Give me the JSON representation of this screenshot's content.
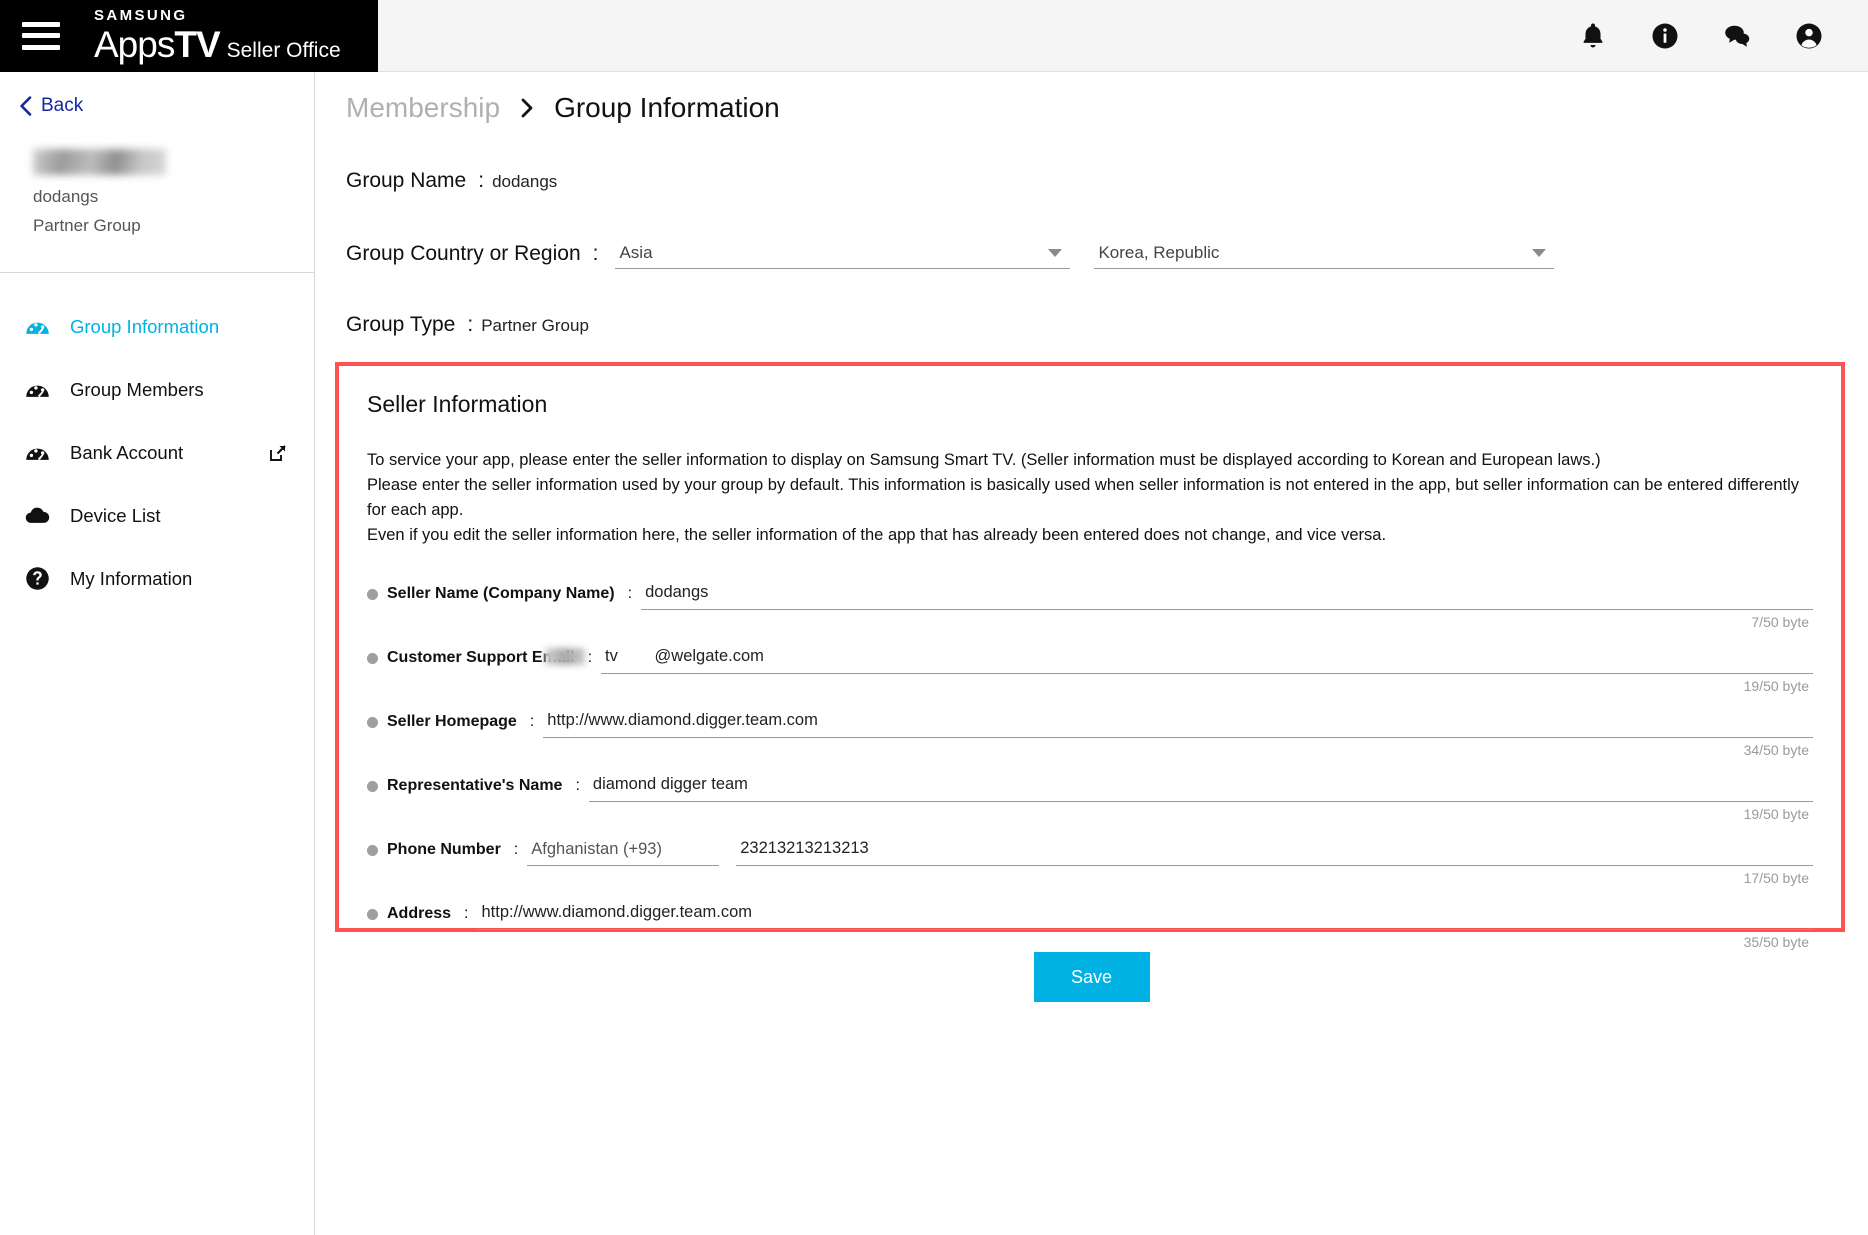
{
  "header": {
    "brand_samsung": "SAMSUNG",
    "brand_apps": "Apps",
    "brand_tv": "TV",
    "brand_seller_office": "Seller Office",
    "menu_icon": "hamburger-menu-icon",
    "icons": [
      "notification-bell-icon",
      "info-icon",
      "chat-icon",
      "account-icon"
    ]
  },
  "sidebar": {
    "back_label": "Back",
    "back_icon": "chevron-left-icon",
    "user_name_masked": "",
    "group_name": "dodangs",
    "group_type": "Partner Group",
    "items": [
      {
        "label": "Group Information",
        "icon": "dashboard-gauge-icon",
        "active": true,
        "external": false
      },
      {
        "label": "Group Members",
        "icon": "dashboard-gauge-icon",
        "active": false,
        "external": false
      },
      {
        "label": "Bank Account",
        "icon": "dashboard-gauge-icon",
        "active": false,
        "external": true
      },
      {
        "label": "Device List",
        "icon": "cloud-icon",
        "active": false,
        "external": false
      },
      {
        "label": "My Information",
        "icon": "help-circle-icon",
        "active": false,
        "external": false
      }
    ]
  },
  "breadcrumb": {
    "parent": "Membership",
    "separator_icon": "chevron-right-icon",
    "current": "Group Information"
  },
  "group": {
    "name_label": "Group Name",
    "name_value": "dodangs",
    "region_label": "Group Country or Region",
    "region_value": "Asia",
    "country_value": "Korea, Republic",
    "type_label": "Group Type",
    "type_value": "Partner Group",
    "colon": ":"
  },
  "seller": {
    "title": "Seller Information",
    "description_line1": "To service your app, please enter the seller information to display on Samsung Smart TV. (Seller information must be displayed according to Korean and European laws.)",
    "description_line2": "Please enter the seller information used by your group by default. This information is basically used when seller information is not entered in the app, but seller information can be entered differently for each app.",
    "description_line3": "Even if you edit the seller information here, the seller information of the app that has already been entered does not change, and vice versa.",
    "fields": [
      {
        "label": "Seller Name (Company Name)",
        "value": "dodangs",
        "bytes": "7/50 byte"
      },
      {
        "label": "Customer Support Email",
        "value": "tv        @welgate.com",
        "bytes": "19/50 byte"
      },
      {
        "label": "Seller Homepage",
        "value": "http://www.diamond.digger.team.com",
        "bytes": "34/50 byte"
      },
      {
        "label": "Representative's Name",
        "value": "diamond digger team",
        "bytes": "19/50 byte"
      },
      {
        "label": "Phone Number",
        "value": "23213213213213",
        "bytes": "17/50 byte",
        "country_code": "Afghanistan (+93)"
      },
      {
        "label": "Address",
        "value": "http://www.diamond.digger.team.com",
        "bytes": "35/50 byte"
      }
    ]
  },
  "footer": {
    "save_label": "Save"
  },
  "colors": {
    "accent": "#00b2e3",
    "highlight_border": "#ff5252",
    "link": "#1428a0"
  }
}
